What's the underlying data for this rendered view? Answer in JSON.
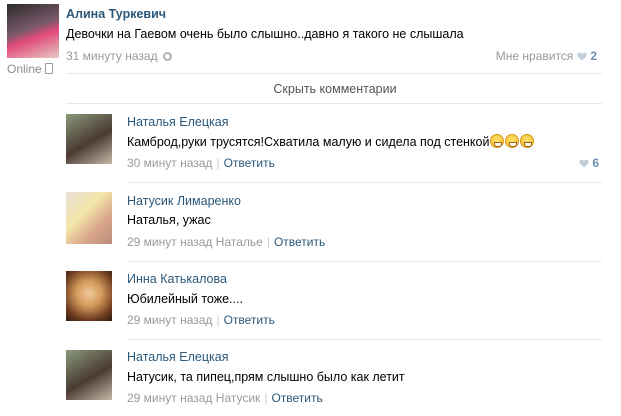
{
  "post": {
    "author": "Алина Туркевич",
    "text": "Девочки на Гаевом очень было слышно..давно я такого не слышала",
    "time": "31 минуту назад",
    "like_label": "Мне нравится",
    "like_count": "2",
    "online_label": "Online"
  },
  "hide_comments_label": "Скрыть комментарии",
  "comments": [
    {
      "author": "Наталья Елецкая",
      "text": "Камброд,руки трусятся!Схватила малую и сидела под стенкой",
      "time": "30 минут назад",
      "reply_to": "",
      "reply_label": "Ответить",
      "likes": "6"
    },
    {
      "author": "Натусик Лимаренко",
      "text": "Наталья, ужас",
      "time": "29 минут назад",
      "reply_to": "Наталье",
      "reply_label": "Ответить",
      "likes": ""
    },
    {
      "author": "Инна Катькалова",
      "text": "Юбилейный тоже....",
      "time": "29 минут назад",
      "reply_to": "",
      "reply_label": "Ответить",
      "likes": ""
    },
    {
      "author": "Наталья Елецкая",
      "text": "Натусик, та пипец,прям слышно было как летит",
      "time": "29 минут назад",
      "reply_to": "Натусик",
      "reply_label": "Ответить",
      "likes": ""
    }
  ],
  "icons": {
    "like": "heart-icon",
    "settings": "gear-icon",
    "phone": "phone-icon",
    "emoji": "grimace-emoji-icon"
  },
  "colors": {
    "link": "#2b587a",
    "meta": "#999999",
    "divider": "#e7e8ec"
  }
}
